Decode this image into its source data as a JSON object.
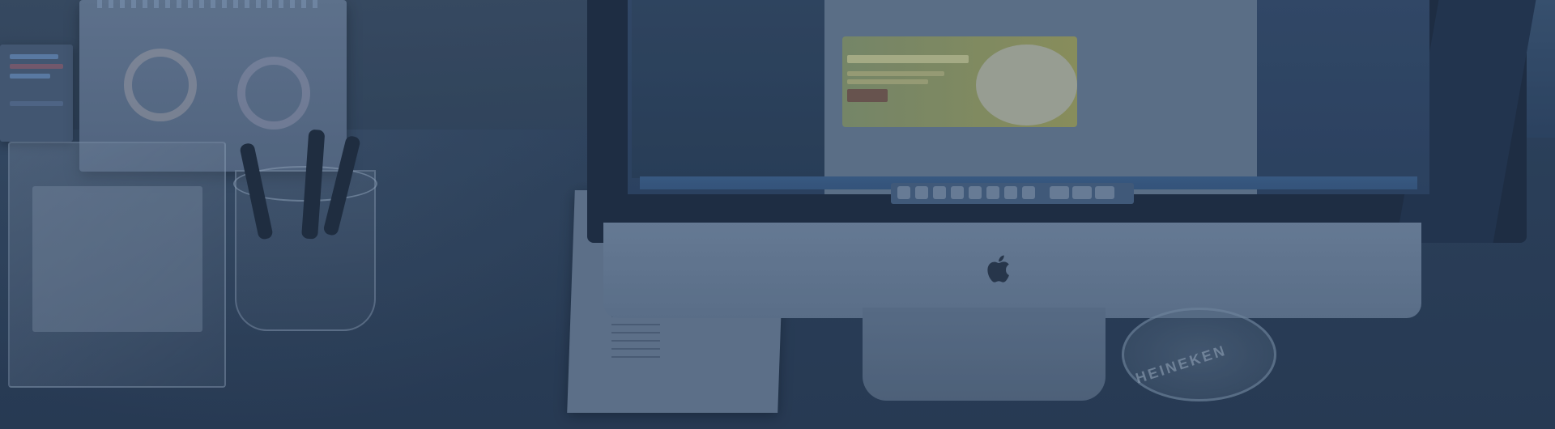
{
  "scene": {
    "description_free": true,
    "overlay_color": "#223a60",
    "coaster_text": "HEINEKEN"
  },
  "colors": {
    "background": "#2b3c52",
    "monitor_frame": "#1e2a3b",
    "taskbar": "#3a5a82",
    "banner": "#a5a45b"
  },
  "icons": {
    "logo": "apple-logo-icon"
  }
}
